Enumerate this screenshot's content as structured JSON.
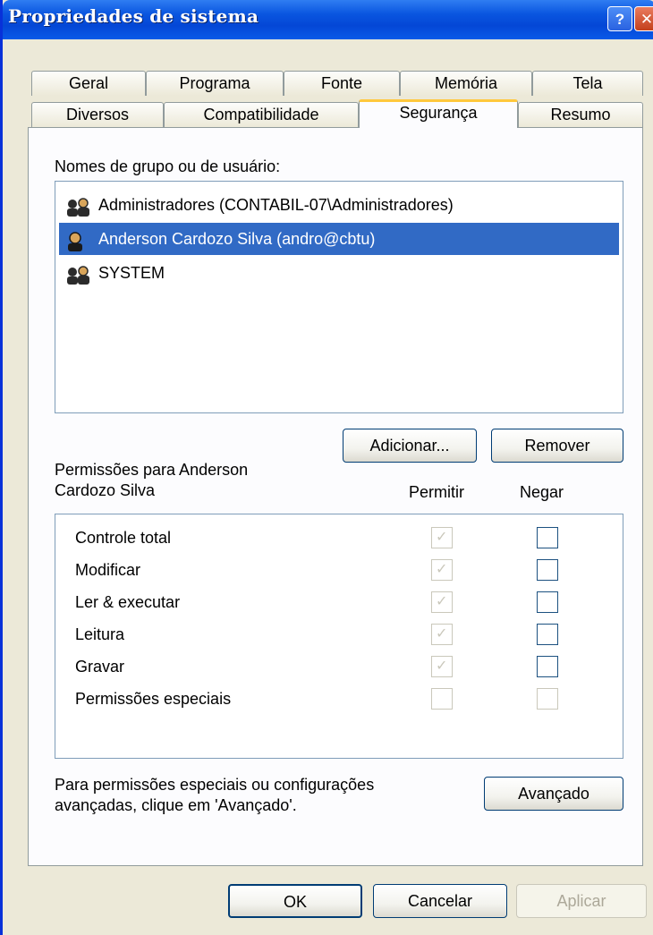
{
  "window": {
    "title": "Propriedades de sistema"
  },
  "titlebar": {
    "help_glyph": "?",
    "close_glyph": "✕"
  },
  "tabs_row1": [
    "Geral",
    "Programa",
    "Fonte",
    "Memória",
    "Tela"
  ],
  "tabs_row2": [
    "Diversos",
    "Compatibilidade",
    "Segurança",
    "Resumo"
  ],
  "active_tab": "Segurança",
  "groups": {
    "label": "Nomes de grupo ou de usuário:",
    "items": [
      {
        "name": "Administradores (CONTABIL-07\\Administradores)",
        "icon": "group-users-icon",
        "selected": false
      },
      {
        "name": "Anderson Cardozo Silva (andro@cbtu)",
        "icon": "user-icon",
        "selected": true
      },
      {
        "name": "SYSTEM",
        "icon": "group-users-icon",
        "selected": false
      }
    ]
  },
  "buttons": {
    "add": "Adicionar...",
    "remove": "Remover",
    "advanced": "Avançado",
    "ok": "OK",
    "cancel": "Cancelar",
    "apply": "Aplicar"
  },
  "permissions": {
    "label_line1": "Permissões para Anderson",
    "label_line2": "Cardozo Silva",
    "col_allow": "Permitir",
    "col_deny": "Negar",
    "rows": [
      {
        "name": "Controle total",
        "allow": true,
        "deny": false
      },
      {
        "name": "Modificar",
        "allow": true,
        "deny": false
      },
      {
        "name": "Ler & executar",
        "allow": true,
        "deny": false
      },
      {
        "name": "Leitura",
        "allow": true,
        "deny": false
      },
      {
        "name": "Gravar",
        "allow": true,
        "deny": false
      },
      {
        "name": "Permissões especiais",
        "allow": false,
        "deny": false,
        "deny_disabled": true
      }
    ]
  },
  "advanced_note": {
    "line1": "Para permissões especiais ou configurações",
    "line2": "avançadas, clique em 'Avançado'."
  },
  "colors": {
    "titlebar": "#0a56e0",
    "selection": "#316ac5",
    "active_tab_accent": "#ffc83c",
    "dialog_bg": "#ece9d8"
  }
}
